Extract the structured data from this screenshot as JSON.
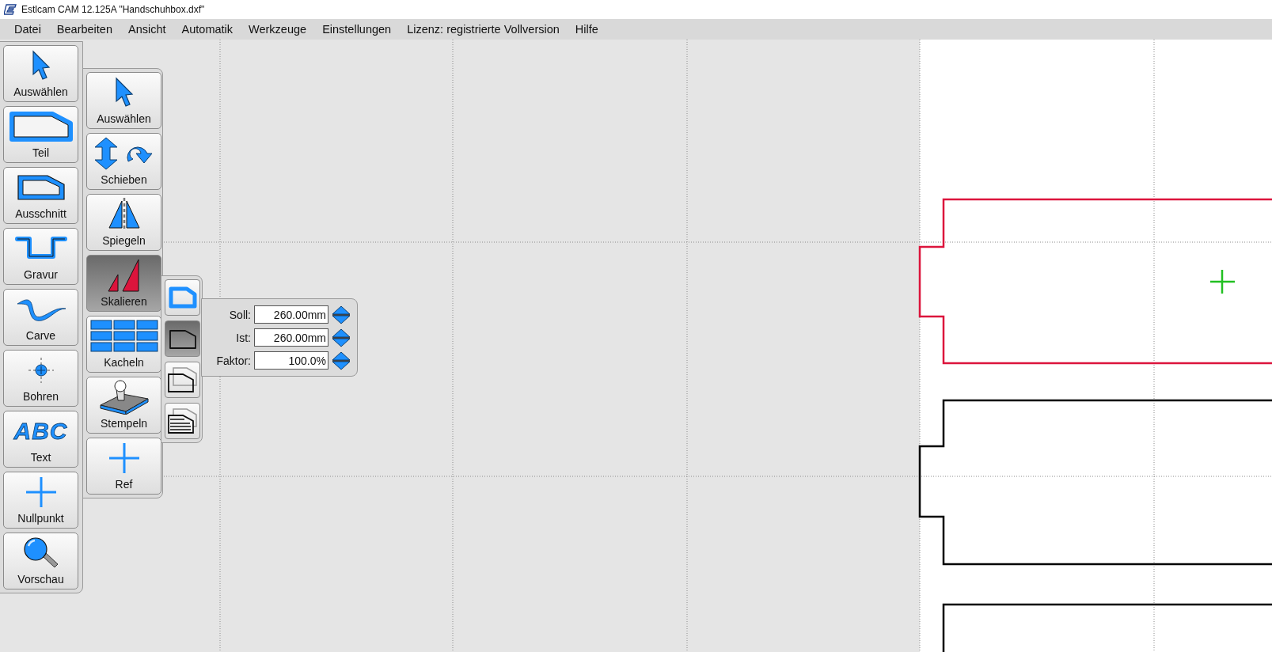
{
  "window": {
    "title": "Estlcam CAM 12.125A \"Handschuhbox.dxf\""
  },
  "menu": [
    "Datei",
    "Bearbeiten",
    "Ansicht",
    "Automatik",
    "Werkzeuge",
    "Einstellungen",
    "Lizenz: registrierte Vollversion",
    "Hilfe"
  ],
  "main_toolbar": [
    {
      "label": "Auswählen",
      "kind": "select",
      "selected": false
    },
    {
      "label": "Teil",
      "kind": "part",
      "selected": false
    },
    {
      "label": "Ausschnitt",
      "kind": "cutout",
      "selected": false
    },
    {
      "label": "Gravur",
      "kind": "engrave",
      "selected": false
    },
    {
      "label": "Carve",
      "kind": "carve",
      "selected": false
    },
    {
      "label": "Bohren",
      "kind": "drill",
      "selected": false
    },
    {
      "label": "Text",
      "kind": "text",
      "glyph": "ABC",
      "selected": false
    },
    {
      "label": "Nullpunkt",
      "kind": "origin",
      "selected": false
    },
    {
      "label": "Vorschau",
      "kind": "preview",
      "selected": false
    }
  ],
  "sub_toolbar": [
    {
      "label": "Auswählen",
      "kind": "select",
      "selected": false
    },
    {
      "label": "Schieben",
      "kind": "move",
      "selected": false
    },
    {
      "label": "Spiegeln",
      "kind": "mirror",
      "selected": false
    },
    {
      "label": "Skalieren",
      "kind": "scale",
      "selected": true
    },
    {
      "label": "Kacheln",
      "kind": "tile",
      "selected": false
    },
    {
      "label": "Stempeln",
      "kind": "stamp",
      "selected": false
    },
    {
      "label": "Ref",
      "kind": "origin",
      "selected": false
    }
  ],
  "scope_toolbar": [
    {
      "kind": "outline-blue",
      "selected": false
    },
    {
      "kind": "outline",
      "selected": true
    },
    {
      "kind": "stacked",
      "selected": false
    },
    {
      "kind": "lines",
      "selected": false
    }
  ],
  "scale_panel": {
    "fields": [
      {
        "label": "Soll:",
        "value": "260.00mm"
      },
      {
        "label": "Ist:",
        "value": "260.00mm"
      },
      {
        "label": "Faktor:",
        "value": "100.0%"
      }
    ]
  },
  "canvas": {
    "parts": [
      {
        "selected": true
      },
      {
        "selected": false
      },
      {
        "selected": false
      }
    ]
  }
}
